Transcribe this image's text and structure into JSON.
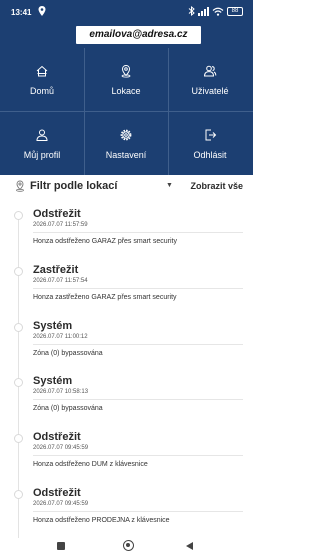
{
  "status_bar": {
    "time": "13:41",
    "battery": "88"
  },
  "header": {
    "email": "emailova@adresa.cz"
  },
  "menu": [
    {
      "label": "Domů",
      "icon": "home-icon"
    },
    {
      "label": "Lokace",
      "icon": "location-icon"
    },
    {
      "label": "Uživatelé",
      "icon": "users-icon"
    },
    {
      "label": "Můj profil",
      "icon": "profile-icon"
    },
    {
      "label": "Nastavení",
      "icon": "settings-icon"
    },
    {
      "label": "Odhlásit",
      "icon": "logout-icon"
    }
  ],
  "filter": {
    "title": "Filtr podle lokací",
    "show_all": "Zobrazit vše"
  },
  "events": [
    {
      "title": "Odstřežit",
      "time": "2026.07.07 11:57:59",
      "desc": "Honza odstřeženo GARAZ přes smart security"
    },
    {
      "title": "Zastřežit",
      "time": "2026.07.07 11:57:54",
      "desc": "Honza zastřeženo GARAZ přes smart security"
    },
    {
      "title": "Systém",
      "time": "2026.07.07 11:00:12",
      "desc": "Zóna (0) bypassována"
    },
    {
      "title": "Systém",
      "time": "2026.07.07 10:58:13",
      "desc": "Zóna (0) bypassována"
    },
    {
      "title": "Odstřežit",
      "time": "2026.07.07 09:45:59",
      "desc": "Honza odstřeženo DUM z klávesnice"
    },
    {
      "title": "Odstřežit",
      "time": "2026.07.07 09:45:59",
      "desc": "Honza odstřeženo PRODEJNA z klávesnice"
    }
  ],
  "colors": {
    "header_bg": "#1c3f72",
    "text": "#2b2b2b"
  }
}
